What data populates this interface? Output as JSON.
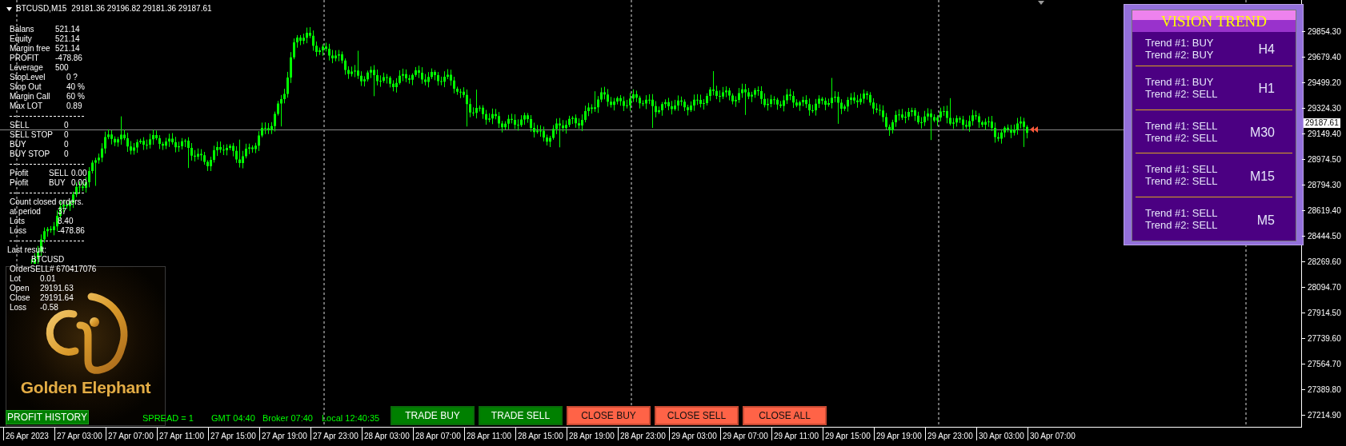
{
  "chart": {
    "symbol": "BTCUSD,M15",
    "quotes": "29181.36 29196.82 29181.36 29187.61"
  },
  "account": {
    "rows": [
      {
        "label": "Balans",
        "value": "521.14"
      },
      {
        "label": "Equity",
        "value": "521.14"
      },
      {
        "label": "Margin free",
        "value": "521.14"
      },
      {
        "label": "PROFIT",
        "value": "-478.86"
      },
      {
        "label": "Leverage",
        "value": "500"
      },
      {
        "label": "StopLevel",
        "value": "0 ?"
      },
      {
        "label": "Stop Out",
        "value": "40 %"
      },
      {
        "label": "Margin Call",
        "value": "60 %"
      },
      {
        "label": "Max LOT",
        "value": "0.89"
      }
    ],
    "orders": [
      {
        "label": "SELL",
        "value": "0"
      },
      {
        "label": "SELL STOP",
        "value": "0"
      },
      {
        "label": "BUY",
        "value": "0"
      },
      {
        "label": "BUY STOP",
        "value": "0"
      }
    ],
    "profit": [
      {
        "label": "Profit",
        "side": "SELL",
        "value": "0.00"
      },
      {
        "label": "Profit",
        "side": "BUY",
        "value": "0.00"
      }
    ],
    "closed_title": "Count closed orders.",
    "closed": [
      {
        "label": "at period",
        "value": "37"
      },
      {
        "label": "Lots",
        "value": "8.40"
      },
      {
        "label": "Loss",
        "value": "-478.86"
      }
    ],
    "last_title": "Last result:",
    "last_symbol": "BTCUSD",
    "last_order": {
      "label": "Order",
      "side": "SELL",
      "ticket": "# 670417076"
    },
    "last_rows": [
      {
        "label": "Lot",
        "value": "0.01"
      },
      {
        "label": "Open",
        "value": "29191.63"
      },
      {
        "label": "Close",
        "value": "29191.64"
      },
      {
        "label": "Loss",
        "value": "-0.58"
      }
    ]
  },
  "logo": {
    "name": "Golden Elephant"
  },
  "vision_trend": {
    "title": "VISION TREND",
    "rows": [
      {
        "trend_1": "Trend #1: BUY",
        "trend_2": "Trend #2: BUY",
        "timeframe": "H4"
      },
      {
        "trend_1": "Trend #1: BUY",
        "trend_2": "Trend #2: SELL",
        "timeframe": "H1"
      },
      {
        "trend_1": "Trend #1: SELL",
        "trend_2": "Trend #2: SELL",
        "timeframe": "M30"
      },
      {
        "trend_1": "Trend #1: SELL",
        "trend_2": "Trend #2: SELL",
        "timeframe": "M15"
      },
      {
        "trend_1": "Trend #1: SELL",
        "trend_2": "Trend #2: SELL",
        "timeframe": "M5"
      }
    ]
  },
  "price_axis": {
    "labels": [
      "29854.30",
      "29679.40",
      "29499.20",
      "29324.30",
      "29149.40",
      "28974.50",
      "28794.30",
      "28619.40",
      "28444.50",
      "28269.60",
      "28094.70",
      "27914.50",
      "27739.60",
      "27564.70",
      "27389.80",
      "27214.90"
    ],
    "current_price": "29187.61"
  },
  "time_axis": {
    "labels": [
      "26 Apr 2023",
      "27 Apr 03:00",
      "27 Apr 07:00",
      "27 Apr 11:00",
      "27 Apr 15:00",
      "27 Apr 19:00",
      "27 Apr 23:00",
      "28 Apr 03:00",
      "28 Apr 07:00",
      "28 Apr 11:00",
      "28 Apr 15:00",
      "28 Apr 19:00",
      "28 Apr 23:00",
      "29 Apr 03:00",
      "29 Apr 07:00",
      "29 Apr 11:00",
      "29 Apr 15:00",
      "29 Apr 19:00",
      "29 Apr 23:00",
      "30 Apr 03:00",
      "30 Apr 07:00"
    ]
  },
  "status": {
    "profit_history": "PROFIT HISTORY",
    "spread": "SPREAD = 1",
    "gmt": "GMT 04:40",
    "broker": "Broker 07:40",
    "local": "Local 12:40:35"
  },
  "buttons": [
    {
      "label": "TRADE BUY",
      "kind": "trade"
    },
    {
      "label": "TRADE SELL",
      "kind": "trade"
    },
    {
      "label": "CLOSE BUY",
      "kind": "close"
    },
    {
      "label": "CLOSE SELL",
      "kind": "close"
    },
    {
      "label": "CLOSE ALL",
      "kind": "close"
    }
  ]
}
